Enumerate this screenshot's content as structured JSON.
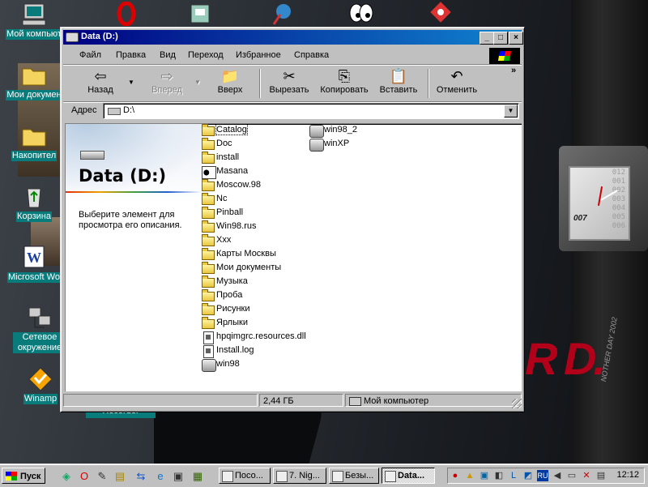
{
  "desktop": {
    "icons": [
      {
        "label": "Мой компьют",
        "icon": "my-computer-icon"
      },
      {
        "label": "Мои докумен",
        "icon": "my-documents-icon"
      },
      {
        "label": "Накопител",
        "icon": "briefcase-folder-icon"
      },
      {
        "label": "Корзина",
        "icon": "recycle-bin-icon"
      },
      {
        "label": "Microsoft Wo",
        "icon": "word-icon"
      },
      {
        "label": "Сетевое окружение",
        "icon": "network-icon"
      },
      {
        "label": "Winamp",
        "icon": "winamp-icon"
      }
    ],
    "wallpaper_text": {
      "watch_digits": [
        "012",
        "001",
        "002",
        "003",
        "004",
        "005",
        "006"
      ],
      "watch_brand": "007",
      "red_text": "R D.",
      "side_text": "NOTHER DAY 2002",
      "recorder": "Recorder"
    }
  },
  "window": {
    "title": "Data (D:)",
    "controls": {
      "minimize": "_",
      "maximize": "□",
      "close": "×"
    },
    "menu": [
      "Файл",
      "Правка",
      "Вид",
      "Переход",
      "Избранное",
      "Справка"
    ],
    "toolbar": {
      "back": "Назад",
      "forward": "Вперед",
      "up": "Вверх",
      "cut": "Вырезать",
      "copy": "Копировать",
      "paste": "Вставить",
      "undo": "Отменить",
      "more": "»"
    },
    "address": {
      "label": "Адрес",
      "value": "D:\\"
    },
    "left_pane": {
      "title": "Data (D:)",
      "description": "Выберите элемент для просмотра его описания."
    },
    "files": [
      {
        "name": "Catalog",
        "type": "folder",
        "selected": true
      },
      {
        "name": "Doc",
        "type": "folder"
      },
      {
        "name": "install",
        "type": "folder"
      },
      {
        "name": "Masana",
        "type": "image"
      },
      {
        "name": "Moscow.98",
        "type": "folder"
      },
      {
        "name": "Nc",
        "type": "folder"
      },
      {
        "name": "Pinball",
        "type": "folder"
      },
      {
        "name": "Win98.rus",
        "type": "folder"
      },
      {
        "name": "Xxx",
        "type": "folder"
      },
      {
        "name": "Карты Москвы",
        "type": "folder"
      },
      {
        "name": "Мои документы",
        "type": "special-folder"
      },
      {
        "name": "Музыка",
        "type": "folder"
      },
      {
        "name": "Проба",
        "type": "folder"
      },
      {
        "name": "Рисунки",
        "type": "folder"
      },
      {
        "name": "Ярлыки",
        "type": "folder"
      },
      {
        "name": "hpqimgrc.resources.dll",
        "type": "file"
      },
      {
        "name": "Install.log",
        "type": "file"
      },
      {
        "name": "win98",
        "type": "exe"
      },
      {
        "name": "win98_2",
        "type": "exe"
      },
      {
        "name": "winXP",
        "type": "exe"
      }
    ],
    "status": {
      "left": "",
      "size": "2,44 ГБ",
      "location": "Мой компьютер"
    }
  },
  "taskbar": {
    "start_label": "Пуск",
    "quick_launch": [
      "desktop-icon",
      "opera-icon",
      "notepad-icon",
      "explorer-icon",
      "ie-icon",
      "tv-icon",
      "media-icon"
    ],
    "tasks": [
      {
        "label": "Посо...",
        "active": false
      },
      {
        "label": "7. Nig...",
        "active": false
      },
      {
        "label": "Безы...",
        "active": false
      },
      {
        "label": "Data...",
        "active": true
      }
    ],
    "tray_lang": "RU",
    "clock": "12:12"
  }
}
